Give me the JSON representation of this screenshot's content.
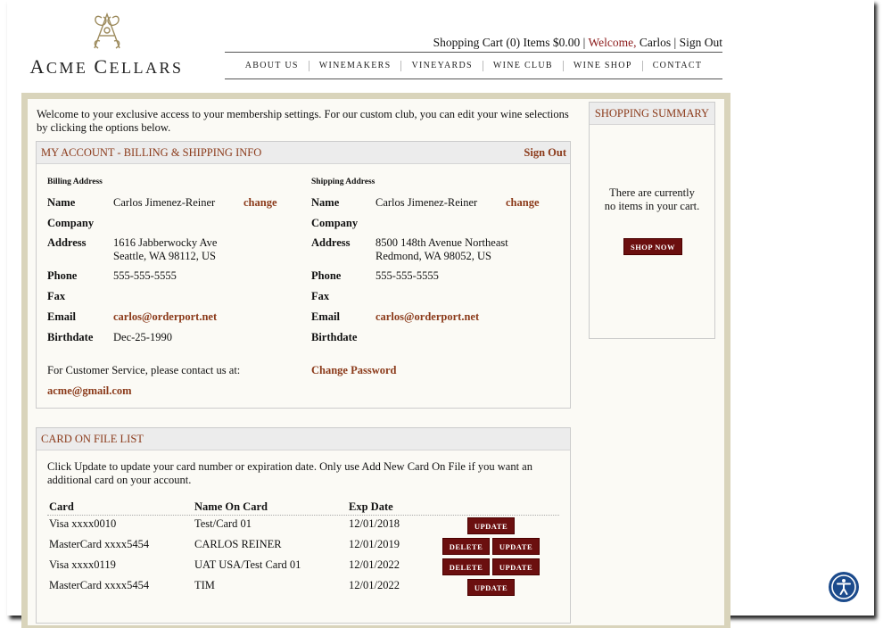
{
  "header": {
    "logo_text_first": "A",
    "logo_text_rest_1": "CME ",
    "logo_text_c": "C",
    "logo_text_rest_2": "ELLARS",
    "cart_text": "Shopping Cart (0) Items $0.00",
    "separator": "|",
    "welcome_label": "Welcome,",
    "user_name": "Carlos",
    "sign_out": "Sign Out"
  },
  "nav": {
    "items": [
      "ABOUT US",
      "WINEMAKERS",
      "VINEYARDS",
      "WINE CLUB",
      "WINE SHOP",
      "CONTACT"
    ]
  },
  "intro": {
    "text": "Welcome to your exclusive access to your membership settings.  For our custom club, you can edit your wine selections by clicking the options below."
  },
  "account": {
    "title": "MY ACCOUNT - BILLING & SHIPPING INFO",
    "sign_out": "Sign Out",
    "billing": {
      "heading": "Billing Address",
      "name_label": "Name",
      "name": "Carlos Jimenez-Reiner",
      "change": "change",
      "company_label": "Company",
      "address_label": "Address",
      "address_line1": "1616 Jabberwocky Ave",
      "address_line2": "Seattle, WA 98112, US",
      "phone_label": "Phone",
      "phone": "555-555-5555",
      "fax_label": "Fax",
      "email_label": "Email",
      "email": "carlos@orderport.net",
      "birthdate_label": "Birthdate",
      "birthdate": "Dec-25-1990"
    },
    "shipping": {
      "heading": "Shipping Address",
      "name_label": "Name",
      "name": "Carlos Jimenez-Reiner",
      "change": "change",
      "company_label": "Company",
      "address_label": "Address",
      "address_line1": "8500 148th Avenue Northeast",
      "address_line2": "Redmond, WA 98052, US",
      "phone_label": "Phone",
      "phone": "555-555-5555",
      "fax_label": "Fax",
      "email_label": "Email",
      "email": "carlos@orderport.net",
      "birthdate_label": "Birthdate"
    },
    "service_text": "For Customer Service, please contact us at:",
    "service_email": "acme@gmail.com",
    "change_password": "Change Password"
  },
  "cards": {
    "title": "CARD ON FILE LIST",
    "instructions": "Click Update to update your card number or expiration date. Only use Add New Card On File if you want an additional card on your account.",
    "col_card": "Card",
    "col_name": "Name On Card",
    "col_exp": "Exp Date",
    "delete_label": "DELETE",
    "update_label": "UPDATE",
    "rows": [
      {
        "card": "Visa xxxx0010",
        "name": "Test/Card 01",
        "exp": "12/01/2018"
      },
      {
        "card": "MasterCard xxxx5454",
        "name": "CARLOS REINER",
        "exp": "12/01/2019"
      },
      {
        "card": "Visa xxxx0119",
        "name": "UAT USA/Test Card 01",
        "exp": "12/01/2022"
      },
      {
        "card": "MasterCard xxxx5454",
        "name": "TIM",
        "exp": "12/01/2022"
      }
    ]
  },
  "summary": {
    "title": "SHOPPING SUMMARY",
    "empty_line1": "There are currently",
    "empty_line2": "no items in your cart.",
    "shop_now": "SHOP NOW"
  },
  "colors": {
    "accent": "#8b3a1a",
    "button": "#6b0f0f",
    "border_tan": "#d9d4bb",
    "welcome": "#8b1a1a"
  },
  "icons": {
    "logo": "acme-monogram-logo",
    "accessibility": "accessibility-icon"
  }
}
